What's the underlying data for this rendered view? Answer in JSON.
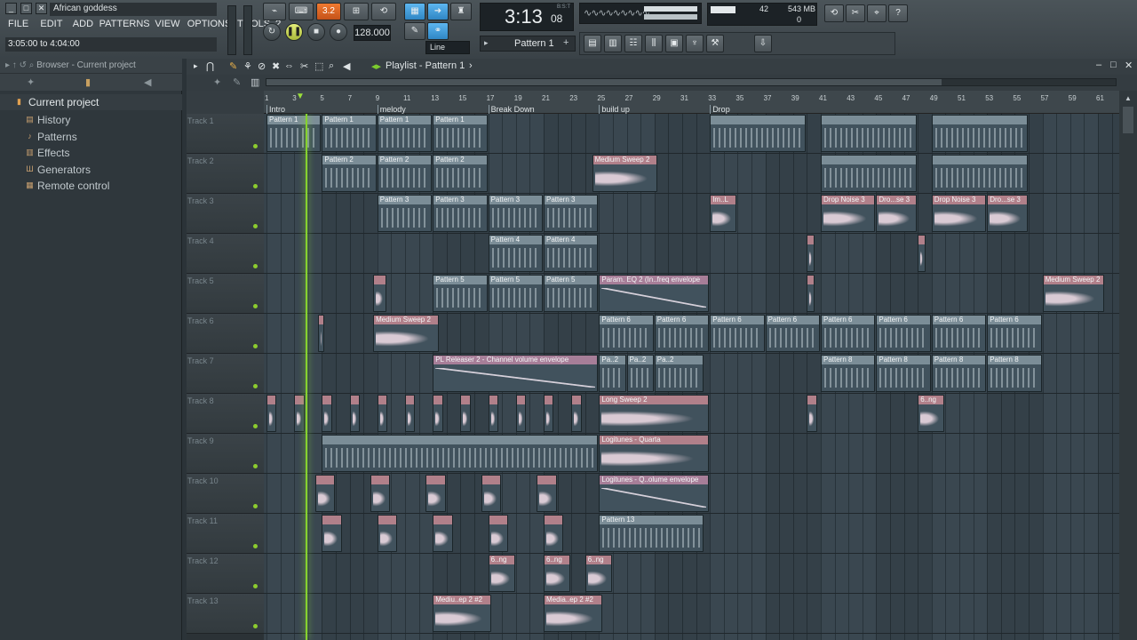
{
  "window": {
    "project": "African goddess",
    "hint": "3:05:00 to 4:04:00"
  },
  "menu": [
    "FILE",
    "EDIT",
    "ADD",
    "PATTERNS",
    "VIEW",
    "OPTIONS",
    "TOOLS",
    "?"
  ],
  "transport": {
    "tempo": "128.000",
    "time": "3:13",
    "time_small": "08",
    "pattern": "Pattern 1",
    "snap": "Line",
    "cpu": "42",
    "memory": "543 MB",
    "voices": "0",
    "mode_button": "3.2",
    "line_label": "B:S:T"
  },
  "browser": {
    "title": "Browser - Current project",
    "root": "Current project",
    "items": [
      "History",
      "Patterns",
      "Effects",
      "Generators",
      "Remote control"
    ]
  },
  "playlist": {
    "title": "Playlist - Pattern 1",
    "bar_numbers": [
      "1",
      "3",
      "5",
      "7",
      "9",
      "11",
      "13",
      "15",
      "17",
      "19",
      "21",
      "23",
      "25",
      "27",
      "29",
      "31",
      "33",
      "35",
      "37",
      "39",
      "41",
      "43",
      "45",
      "47",
      "49",
      "51",
      "53",
      "55",
      "57",
      "59",
      "61"
    ],
    "markers": [
      {
        "text": "Intro",
        "bar": 1
      },
      {
        "text": "melody",
        "bar": 9
      },
      {
        "text": "Break Down",
        "bar": 17
      },
      {
        "text": "build up",
        "bar": 25
      },
      {
        "text": "Drop",
        "bar": 33
      }
    ],
    "tracks": [
      "Track 1",
      "Track 2",
      "Track 3",
      "Track 4",
      "Track 5",
      "Track 6",
      "Track 7",
      "Track 8",
      "Track 9",
      "Track 10",
      "Track 11",
      "Track 12",
      "Track 13"
    ],
    "clips": [
      {
        "t": 0,
        "s": 1,
        "e": 5,
        "label": "Pattern 1",
        "kind": "pattern"
      },
      {
        "t": 0,
        "s": 5,
        "e": 9,
        "label": "Pattern 1",
        "kind": "pattern"
      },
      {
        "t": 0,
        "s": 9,
        "e": 13,
        "label": "Pattern 1",
        "kind": "pattern"
      },
      {
        "t": 0,
        "s": 13,
        "e": 17,
        "label": "Pattern 1",
        "kind": "pattern"
      },
      {
        "t": 0,
        "s": 33,
        "e": 40,
        "label": "",
        "kind": "pattern"
      },
      {
        "t": 0,
        "s": 41,
        "e": 48,
        "label": "",
        "kind": "pattern"
      },
      {
        "t": 0,
        "s": 49,
        "e": 56,
        "label": "",
        "kind": "pattern"
      },
      {
        "t": 1,
        "s": 5,
        "e": 9,
        "label": "Pattern 2",
        "kind": "pattern"
      },
      {
        "t": 1,
        "s": 9,
        "e": 13,
        "label": "Pattern 2",
        "kind": "pattern"
      },
      {
        "t": 1,
        "s": 13,
        "e": 17,
        "label": "Pattern 2",
        "kind": "pattern"
      },
      {
        "t": 1,
        "s": 24.5,
        "e": 29.3,
        "label": "Medium Sweep 2",
        "kind": "audio"
      },
      {
        "t": 1,
        "s": 41,
        "e": 48,
        "label": "",
        "kind": "pattern"
      },
      {
        "t": 1,
        "s": 49,
        "e": 56,
        "label": "",
        "kind": "pattern"
      },
      {
        "t": 2,
        "s": 9,
        "e": 13,
        "label": "Pattern 3",
        "kind": "pattern"
      },
      {
        "t": 2,
        "s": 13,
        "e": 17,
        "label": "Pattern 3",
        "kind": "pattern"
      },
      {
        "t": 2,
        "s": 17,
        "e": 21,
        "label": "Pattern 3",
        "kind": "pattern"
      },
      {
        "t": 2,
        "s": 21,
        "e": 25,
        "label": "Pattern 3",
        "kind": "pattern"
      },
      {
        "t": 2,
        "s": 33,
        "e": 35,
        "label": "Im..L",
        "kind": "audio"
      },
      {
        "t": 2,
        "s": 41,
        "e": 45,
        "label": "Drop Noise 3",
        "kind": "audio"
      },
      {
        "t": 2,
        "s": 45,
        "e": 48,
        "label": "Dro...se 3",
        "kind": "audio"
      },
      {
        "t": 2,
        "s": 49,
        "e": 53,
        "label": "Drop Noise 3",
        "kind": "audio"
      },
      {
        "t": 2,
        "s": 53,
        "e": 56,
        "label": "Dro...se 3",
        "kind": "audio"
      },
      {
        "t": 3,
        "s": 17,
        "e": 21,
        "label": "Pattern 4",
        "kind": "pattern"
      },
      {
        "t": 3,
        "s": 21,
        "e": 25,
        "label": "Pattern 4",
        "kind": "pattern"
      },
      {
        "t": 3,
        "s": 40,
        "e": 40.6,
        "label": "",
        "kind": "audio"
      },
      {
        "t": 3,
        "s": 48,
        "e": 48.6,
        "label": "",
        "kind": "audio"
      },
      {
        "t": 4,
        "s": 8.7,
        "e": 9.7,
        "label": "",
        "kind": "audio"
      },
      {
        "t": 4,
        "s": 13,
        "e": 17,
        "label": "Pattern 5",
        "kind": "pattern"
      },
      {
        "t": 4,
        "s": 17,
        "e": 21,
        "label": "Pattern 5",
        "kind": "pattern"
      },
      {
        "t": 4,
        "s": 21,
        "e": 25,
        "label": "Pattern 5",
        "kind": "pattern"
      },
      {
        "t": 4,
        "s": 25,
        "e": 33,
        "label": "Param. EQ 2 (In..freq envelope",
        "kind": "auto"
      },
      {
        "t": 4,
        "s": 40,
        "e": 40.6,
        "label": "",
        "kind": "audio"
      },
      {
        "t": 4,
        "s": 57,
        "e": 61.5,
        "label": "Medium Sweep 2",
        "kind": "audio"
      },
      {
        "t": 5,
        "s": 4.7,
        "e": 5.2,
        "label": "",
        "kind": "audio"
      },
      {
        "t": 5,
        "s": 8.7,
        "e": 13.5,
        "label": "Medium Sweep 2",
        "kind": "audio"
      },
      {
        "t": 5,
        "s": 25,
        "e": 29,
        "label": "Pattern 6",
        "kind": "pattern"
      },
      {
        "t": 5,
        "s": 29,
        "e": 33,
        "label": "Pattern 6",
        "kind": "pattern"
      },
      {
        "t": 5,
        "s": 33,
        "e": 37,
        "label": "Pattern 6",
        "kind": "pattern"
      },
      {
        "t": 5,
        "s": 37,
        "e": 41,
        "label": "Pattern 6",
        "kind": "pattern"
      },
      {
        "t": 5,
        "s": 41,
        "e": 45,
        "label": "Pattern 6",
        "kind": "pattern"
      },
      {
        "t": 5,
        "s": 45,
        "e": 49,
        "label": "Pattern 6",
        "kind": "pattern"
      },
      {
        "t": 5,
        "s": 49,
        "e": 53,
        "label": "Pattern 6",
        "kind": "pattern"
      },
      {
        "t": 5,
        "s": 53,
        "e": 57,
        "label": "Pattern 6",
        "kind": "pattern"
      },
      {
        "t": 6,
        "s": 13,
        "e": 25,
        "label": "PL Releaser 2 - Channel volume envelope",
        "kind": "auto"
      },
      {
        "t": 6,
        "s": 25,
        "e": 27,
        "label": "Pa..2",
        "kind": "pattern"
      },
      {
        "t": 6,
        "s": 27,
        "e": 29,
        "label": "Pa..2",
        "kind": "pattern"
      },
      {
        "t": 6,
        "s": 29,
        "e": 32.6,
        "label": "Pa..2",
        "kind": "pattern"
      },
      {
        "t": 6,
        "s": 41,
        "e": 45,
        "label": "Pattern 8",
        "kind": "pattern"
      },
      {
        "t": 6,
        "s": 45,
        "e": 49,
        "label": "Pattern 8",
        "kind": "pattern"
      },
      {
        "t": 6,
        "s": 49,
        "e": 53,
        "label": "Pattern 8",
        "kind": "pattern"
      },
      {
        "t": 6,
        "s": 53,
        "e": 57,
        "label": "Pattern 8",
        "kind": "pattern"
      },
      {
        "t": 7,
        "s": 1,
        "e": 1.8,
        "label": "",
        "kind": "audio"
      },
      {
        "t": 7,
        "s": 3,
        "e": 3.8,
        "label": "",
        "kind": "audio"
      },
      {
        "t": 7,
        "s": 5,
        "e": 5.8,
        "label": "",
        "kind": "audio"
      },
      {
        "t": 7,
        "s": 7,
        "e": 7.8,
        "label": "",
        "kind": "audio"
      },
      {
        "t": 7,
        "s": 9,
        "e": 9.8,
        "label": "",
        "kind": "audio"
      },
      {
        "t": 7,
        "s": 11,
        "e": 11.8,
        "label": "",
        "kind": "audio"
      },
      {
        "t": 7,
        "s": 13,
        "e": 13.8,
        "label": "",
        "kind": "audio"
      },
      {
        "t": 7,
        "s": 15,
        "e": 15.8,
        "label": "",
        "kind": "audio"
      },
      {
        "t": 7,
        "s": 17,
        "e": 17.8,
        "label": "",
        "kind": "audio"
      },
      {
        "t": 7,
        "s": 19,
        "e": 19.8,
        "label": "",
        "kind": "audio"
      },
      {
        "t": 7,
        "s": 21,
        "e": 21.8,
        "label": "",
        "kind": "audio"
      },
      {
        "t": 7,
        "s": 23,
        "e": 23.8,
        "label": "",
        "kind": "audio"
      },
      {
        "t": 7,
        "s": 25,
        "e": 33,
        "label": "Long Sweep 2",
        "kind": "audio"
      },
      {
        "t": 7,
        "s": 40,
        "e": 40.8,
        "label": "",
        "kind": "audio"
      },
      {
        "t": 7,
        "s": 48,
        "e": 50,
        "label": "6..ng",
        "kind": "audio"
      },
      {
        "t": 8,
        "s": 5,
        "e": 25,
        "label": "",
        "kind": "pattern"
      },
      {
        "t": 8,
        "s": 25,
        "e": 33,
        "label": "Logitunes - Quarta",
        "kind": "audio"
      },
      {
        "t": 9,
        "s": 4.5,
        "e": 6,
        "label": "",
        "kind": "audio"
      },
      {
        "t": 9,
        "s": 8.5,
        "e": 10,
        "label": "",
        "kind": "audio"
      },
      {
        "t": 9,
        "s": 12.5,
        "e": 14,
        "label": "",
        "kind": "audio"
      },
      {
        "t": 9,
        "s": 16.5,
        "e": 18,
        "label": "",
        "kind": "audio"
      },
      {
        "t": 9,
        "s": 20.5,
        "e": 22,
        "label": "",
        "kind": "audio"
      },
      {
        "t": 9,
        "s": 25,
        "e": 33,
        "label": "Logitunes - Q..olume envelope",
        "kind": "auto"
      },
      {
        "t": 10,
        "s": 5,
        "e": 6.5,
        "label": "",
        "kind": "audio"
      },
      {
        "t": 10,
        "s": 9,
        "e": 10.5,
        "label": "",
        "kind": "audio"
      },
      {
        "t": 10,
        "s": 13,
        "e": 14.5,
        "label": "",
        "kind": "audio"
      },
      {
        "t": 10,
        "s": 17,
        "e": 18.5,
        "label": "",
        "kind": "audio"
      },
      {
        "t": 10,
        "s": 21,
        "e": 22.5,
        "label": "",
        "kind": "audio"
      },
      {
        "t": 10,
        "s": 25,
        "e": 32.6,
        "label": "Pattern 13",
        "kind": "pattern"
      },
      {
        "t": 11,
        "s": 17,
        "e": 19,
        "label": "6..ng",
        "kind": "audio"
      },
      {
        "t": 11,
        "s": 21,
        "e": 23,
        "label": "6..ng",
        "kind": "audio"
      },
      {
        "t": 11,
        "s": 24,
        "e": 26,
        "label": "6..ng",
        "kind": "audio"
      },
      {
        "t": 12,
        "s": 13,
        "e": 17.3,
        "label": "Mediu..ep 2 #2",
        "kind": "audio"
      },
      {
        "t": 12,
        "s": 21,
        "e": 25.3,
        "label": "Media..ep 2 #2",
        "kind": "audio"
      }
    ]
  }
}
